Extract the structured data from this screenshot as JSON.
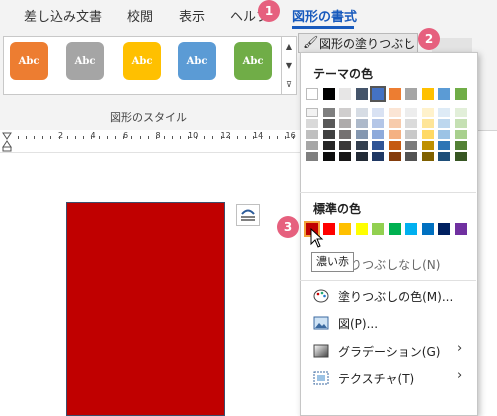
{
  "tabs": [
    {
      "label": "差し込み文書"
    },
    {
      "label": "校閲"
    },
    {
      "label": "表示"
    },
    {
      "label": "ヘルプ"
    },
    {
      "label": "図形の書式"
    }
  ],
  "ribbon": {
    "style_swatches": [
      {
        "text": "Abc",
        "color": "#ed7d31"
      },
      {
        "text": "Abc",
        "color": "#a5a5a5"
      },
      {
        "text": "Abc",
        "color": "#ffc000"
      },
      {
        "text": "Abc",
        "color": "#5b9bd5"
      },
      {
        "text": "Abc",
        "color": "#70ad47"
      }
    ],
    "group_label": "図形のスタイル",
    "fill_button_label": "図形の塗りつぶし"
  },
  "ruler": {
    "labels": [
      "2",
      "4",
      "6",
      "8",
      "10",
      "12",
      "14",
      "16"
    ]
  },
  "fill_menu": {
    "theme_colors_heading": "テーマの色",
    "theme_colors": [
      [
        "#ffffff",
        "#f2f2f2",
        "#d9d9d9",
        "#bfbfbf",
        "#a6a6a6",
        "#7f7f7f"
      ],
      [
        "#000000",
        "#7f7f7f",
        "#595959",
        "#404040",
        "#262626",
        "#0d0d0d"
      ],
      [
        "#e7e6e6",
        "#d0cece",
        "#aeabab",
        "#757171",
        "#3a3838",
        "#171616"
      ],
      [
        "#44546a",
        "#d6dce4",
        "#adb9ca",
        "#8497b0",
        "#333f4f",
        "#222a35"
      ],
      [
        "#4472c4",
        "#d9e2f3",
        "#b4c6e7",
        "#8eaadb",
        "#2f5496",
        "#1f3864"
      ],
      [
        "#ed7d31",
        "#fbe5d5",
        "#f7cbac",
        "#f4b183",
        "#c55a11",
        "#843c0c"
      ],
      [
        "#a5a5a5",
        "#ededed",
        "#dbdbdb",
        "#c9c9c9",
        "#7b7b7b",
        "#525252"
      ],
      [
        "#ffc000",
        "#fff2cc",
        "#fee599",
        "#ffd965",
        "#bf9000",
        "#7f6000"
      ],
      [
        "#5b9bd5",
        "#deebf6",
        "#bdd7ee",
        "#9cc3e5",
        "#2e75b5",
        "#1e4e79"
      ],
      [
        "#70ad47",
        "#e2efd9",
        "#c5e0b3",
        "#a8d08d",
        "#538135",
        "#375623"
      ]
    ],
    "standard_colors_heading": "標準の色",
    "standard_colors": [
      "#c00000",
      "#ff0000",
      "#ffc000",
      "#ffff00",
      "#92d050",
      "#00b050",
      "#00b0f0",
      "#0070c0",
      "#002060",
      "#7030a0"
    ],
    "tooltip": "濃い赤",
    "no_fill_label": "塗りつぶしなし(N)",
    "more_colors_label": "塗りつぶしの色(M)...",
    "picture_label": "図(P)...",
    "gradient_label": "グラデーション(G)",
    "texture_label": "テクスチャ(T)"
  },
  "badges": {
    "b1": "1",
    "b2": "2",
    "b3": "3"
  },
  "colors": {
    "accent": "#185abd",
    "badge": "#e6607e",
    "shape_fill": "#c00000"
  }
}
